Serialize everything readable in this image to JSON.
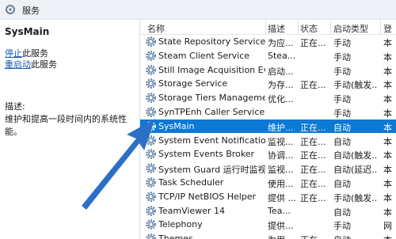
{
  "header": {
    "title": "服务"
  },
  "left_panel": {
    "service_name": "SysMain",
    "stop_link": "停止",
    "stop_suffix": "此服务",
    "restart_link": "重启动",
    "restart_suffix": "此服务",
    "description_label": "描述:",
    "description_text": "维护和提高一段时间内的系统性能。"
  },
  "columns": {
    "name": "名称",
    "description": "描述",
    "status": "状态",
    "startup": "启动类型",
    "logon": "登"
  },
  "rows": [
    {
      "name": "State Repository Service",
      "desc": "为应...",
      "status": "正在...",
      "startup": "手动",
      "logon": "本"
    },
    {
      "name": "Steam Client Service",
      "desc": "Stea...",
      "status": "",
      "startup": "手动",
      "logon": "本"
    },
    {
      "name": "Still Image Acquisition Eve...",
      "desc": "启动...",
      "status": "",
      "startup": "手动",
      "logon": "本"
    },
    {
      "name": "Storage Service",
      "desc": "为存...",
      "status": "正在...",
      "startup": "手动(触发...",
      "logon": "本"
    },
    {
      "name": "Storage Tiers Management",
      "desc": "优化...",
      "status": "",
      "startup": "手动",
      "logon": "本"
    },
    {
      "name": "SynTPEnh Caller Service",
      "desc": "",
      "status": "",
      "startup": "手动",
      "logon": "本"
    },
    {
      "name": "SysMain",
      "desc": "维护...",
      "status": "正在...",
      "startup": "自动",
      "logon": "本",
      "selected": true
    },
    {
      "name": "System Event Notification ...",
      "desc": "监视...",
      "status": "正在...",
      "startup": "自动",
      "logon": "本"
    },
    {
      "name": "System Events Broker",
      "desc": "协调...",
      "status": "正在...",
      "startup": "自动(触发...",
      "logon": "本"
    },
    {
      "name": "System Guard 运行时监视...",
      "desc": "监视...",
      "status": "正在...",
      "startup": "自动(延迟...",
      "logon": "本"
    },
    {
      "name": "Task Scheduler",
      "desc": "使用...",
      "status": "正在...",
      "startup": "自动",
      "logon": "本"
    },
    {
      "name": "TCP/IP NetBIOS Helper",
      "desc": "提供 ...",
      "status": "正在...",
      "startup": "手动(触发...",
      "logon": "本"
    },
    {
      "name": "TeamViewer 14",
      "desc": "Tea...",
      "status": "",
      "startup": "自动",
      "logon": "本"
    },
    {
      "name": "Telephony",
      "desc": "提供...",
      "status": "",
      "startup": "手动",
      "logon": "网"
    },
    {
      "name": "Themes",
      "desc": "为用...",
      "status": "正在...",
      "startup": "自动",
      "logon": "本"
    }
  ],
  "colors": {
    "selected_bg": "#0c79d4",
    "link": "#1a5fb4",
    "arrow": "#2b6fc7"
  },
  "icons": {
    "row_icon": "gear-icon",
    "header_icon": "services-icon",
    "annotation": "arrow-annotation"
  }
}
